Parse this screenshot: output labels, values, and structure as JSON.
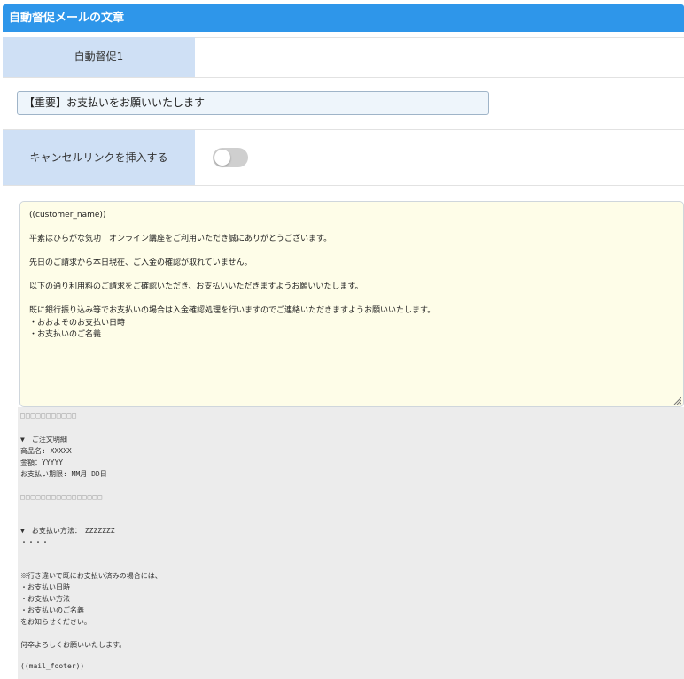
{
  "section": {
    "title": "自動督促メールの文章"
  },
  "tab": {
    "label": "自動督促1"
  },
  "subject": {
    "value": "【重要】お支払いをお願いいたします"
  },
  "cancel_link": {
    "label": "キャンセルリンクを挿入する",
    "enabled": false
  },
  "body_text": {
    "line1": "((customer_name))",
    "line2": "平素はひらがな気功　オンライン講座をご利用いただき誠にありがとうございます。",
    "line3": "先日のご請求から本日現在、ご入金の確認が取れていません。",
    "line4": "以下の通り利用料のご請求をご確認いただき、お支払いいただきますようお願いいたします。",
    "line5": "既に銀行振り込み等でお支払いの場合は入金確認処理を行いますのでご連絡いただきますようお願いいたします。",
    "line6": "・おおよそのお支払い日時",
    "line7": "・お支払いのご名義"
  },
  "fixed_text": {
    "boxes1": "□□□□□□□□□□□",
    "order_heading": "▼　ご注文明細",
    "product": "商品名: XXXXX",
    "amount": "金額：YYYYY",
    "due": "お支払い期限: MM月 DD日",
    "boxes2": "□□□□□□□□□□□□□□□□",
    "payment_method": "▼　お支払い方法：　ZZZZZZZ",
    "dots": "・・・・",
    "note": "※行き違いで既にお支払い済みの場合には、",
    "note_item1": "・お支払い日時",
    "note_item2": "・お支払い方法",
    "note_item3": "・お支払いのご名義",
    "note_end": "をお知らせください。",
    "closing": "何卒よろしくお願いいたします。",
    "footer_var": "((mail_footer))"
  }
}
